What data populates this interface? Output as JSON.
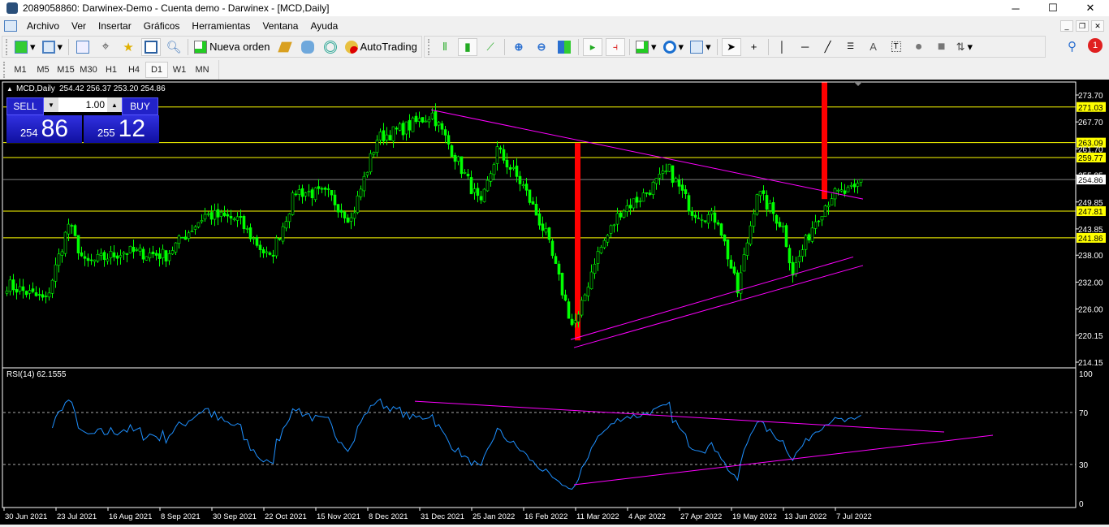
{
  "window": {
    "title": "2089058860: Darwinex-Demo - Cuenta demo - Darwinex - [MCD,Daily]",
    "minimize": "─",
    "maximize": "☐",
    "close": "✕"
  },
  "menu": [
    "Archivo",
    "Ver",
    "Insertar",
    "Gráficos",
    "Herramientas",
    "Ventana",
    "Ayuda"
  ],
  "toolbar": {
    "new_order": "Nueva orden",
    "autotrading": "AutoTrading",
    "notification_count": "1"
  },
  "timeframes": [
    "M1",
    "M5",
    "M15",
    "M30",
    "H1",
    "H4",
    "D1",
    "W1",
    "MN"
  ],
  "active_timeframe": "D1",
  "chart": {
    "symbol_label": "MCD,Daily",
    "ohlc": "254.42 256.37 253.20 254.86",
    "indicator_label": "RSI(14) 62.1555"
  },
  "trade_panel": {
    "sell": "SELL",
    "buy": "BUY",
    "lot": "1.00",
    "bid_prefix": "254",
    "bid_big": "86",
    "ask_prefix": "255",
    "ask_big": "12"
  },
  "chart_data": {
    "type": "candlestick",
    "price_ticks": [
      "273.70",
      "267.70",
      "261.70",
      "255.85",
      "249.85",
      "243.85",
      "238.00",
      "232.00",
      "226.00",
      "220.15",
      "214.15"
    ],
    "price_range": [
      214.15,
      273.7
    ],
    "date_labels": [
      "30 Jun 2021",
      "23 Jul 2021",
      "16 Aug 2021",
      "8 Sep 2021",
      "30 Sep 2021",
      "22 Oct 2021",
      "15 Nov 2021",
      "8 Dec 2021",
      "31 Dec 2021",
      "25 Jan 2022",
      "16 Feb 2022",
      "11 Mar 2022",
      "4 Apr 2022",
      "27 Apr 2022",
      "19 May 2022",
      "13 Jun 2022",
      "7 Jul 2022"
    ],
    "bars_per_label": 16,
    "price_path": [
      [
        0,
        231.5
      ],
      [
        12,
        227.9
      ],
      [
        19,
        245
      ],
      [
        24,
        236
      ],
      [
        36,
        238.8
      ],
      [
        49,
        238
      ],
      [
        61,
        247
      ],
      [
        71,
        246
      ],
      [
        81,
        237
      ],
      [
        89,
        252.3
      ],
      [
        99,
        251.4
      ],
      [
        106,
        246
      ],
      [
        114,
        264
      ],
      [
        124,
        266.8
      ],
      [
        131,
        269.5
      ],
      [
        139,
        258.7
      ],
      [
        146,
        248.8
      ],
      [
        151,
        261.5
      ],
      [
        159,
        253.3
      ],
      [
        166,
        242.5
      ],
      [
        174,
        222.5
      ],
      [
        176,
        224
      ],
      [
        181,
        237
      ],
      [
        189,
        247.9
      ],
      [
        196,
        251.4
      ],
      [
        204,
        256.9
      ],
      [
        211,
        247.9
      ],
      [
        219,
        246
      ],
      [
        225,
        229.8
      ],
      [
        231,
        252.3
      ],
      [
        239,
        244.2
      ],
      [
        242,
        234.2
      ],
      [
        249,
        246
      ],
      [
        254,
        251.4
      ],
      [
        261,
        252.3
      ],
      [
        263,
        254.86
      ]
    ],
    "levels": [
      {
        "price": "271.03",
        "color": "#ffff00"
      },
      {
        "price": "263.09",
        "color": "#ffff00"
      },
      {
        "price": "259.77",
        "color": "#ffff00"
      },
      {
        "price": "247.81",
        "color": "#ffff00"
      },
      {
        "price": "241.86",
        "color": "#ffff00"
      },
      {
        "price": "254.86",
        "color": "#808080"
      }
    ],
    "trendlines": [
      [
        [
          131,
          270.4
        ],
        [
          264,
          250.5
        ]
      ],
      [
        [
          174,
          219.2
        ],
        [
          261,
          237.6
        ]
      ],
      [
        [
          175,
          217.4
        ],
        [
          264,
          235.7
        ]
      ]
    ],
    "red_bars": [
      [
        176,
        219,
        263
      ],
      [
        252,
        250.5,
        280
      ]
    ],
    "rsi": {
      "period": 14,
      "levels": [
        70,
        30
      ],
      "ticks": [
        "100",
        "70",
        "30",
        "0"
      ],
      "trendlines": [
        [
          [
            126,
            78.7
          ],
          [
            289,
            55
          ]
        ],
        [
          [
            175,
            14.4
          ],
          [
            304,
            52.5
          ]
        ]
      ]
    },
    "colors": {
      "candle": "#00ff00",
      "level": "#ffff00",
      "trend": "#ff00ff",
      "rsi": "#1e90ff",
      "red": "#ff0000"
    }
  }
}
